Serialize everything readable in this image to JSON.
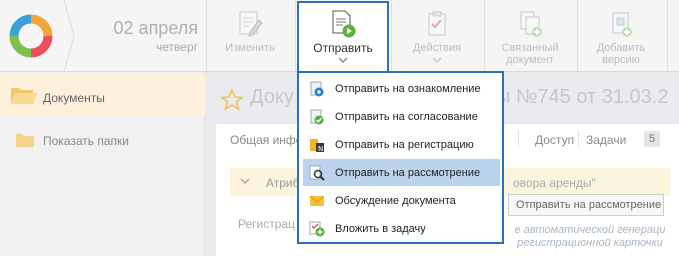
{
  "header": {
    "date": "02 апреля",
    "weekday": "четверг"
  },
  "toolbar": {
    "edit_label": "Изменить",
    "send_label": "Отправить",
    "actions_label": "Действия",
    "related_label_line1": "Связанный",
    "related_label_line2": "документ",
    "add_version_line1": "Добавить",
    "add_version_line2": "версию"
  },
  "send_menu": {
    "items": [
      {
        "label": "Отправить на ознакомление",
        "icon": "eye-arrow-icon"
      },
      {
        "label": "Отправить на согласование",
        "icon": "check-badge-icon"
      },
      {
        "label": "Отправить на регистрацию",
        "icon": "register-icon"
      },
      {
        "label": "Отправить на рассмотрение",
        "icon": "review-magnifier-icon",
        "highlighted": true
      },
      {
        "label": "Обсуждение документа",
        "icon": "envelope-icon"
      },
      {
        "label": "Вложить в задачу",
        "icon": "task-add-icon"
      }
    ]
  },
  "sidebar": {
    "documents_label": "Документы",
    "show_folders_label": "Показать папки"
  },
  "document": {
    "title_start": "Доку",
    "title_end": "ы №745 от 31.03.2"
  },
  "tabs": {
    "general_label": "Общая инфо",
    "access_label": "Доступ",
    "tasks_label": "Задачи",
    "tasks_count": "5"
  },
  "attributes": {
    "section_label": "Атрибу",
    "contract_text": "овора аренды\"",
    "registration_label": "Регистрац",
    "hint_line1": "е автоматической генераци",
    "hint_line2": "регистрационной карточки"
  },
  "tooltip": {
    "text": "Отправить на рассмотрение"
  },
  "colors": {
    "accent_border": "#2f6fb8",
    "menu_highlight": "#bcd3ee",
    "sidebar_active": "#fdf1dc",
    "attr_bar": "#fdf4de"
  }
}
